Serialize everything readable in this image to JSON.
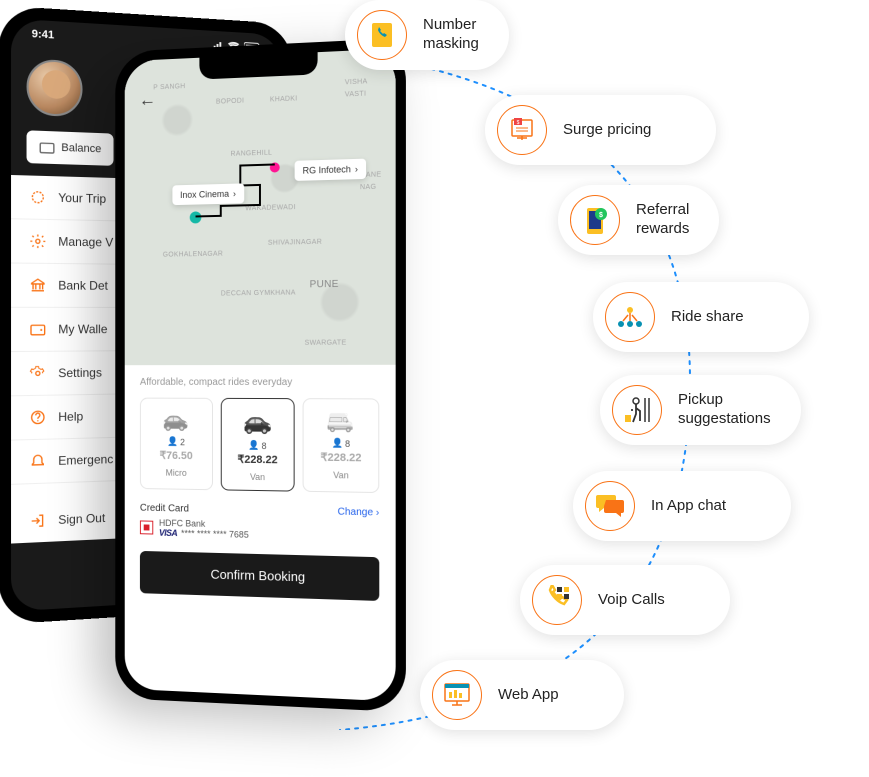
{
  "phone_back": {
    "status_time": "9:41",
    "balance_label": "Balance",
    "menu": [
      {
        "label": "Your Trip",
        "icon": "trips-icon"
      },
      {
        "label": "Manage V",
        "icon": "manage-icon"
      },
      {
        "label": "Bank Det",
        "icon": "bank-icon"
      },
      {
        "label": "My Walle",
        "icon": "wallet-icon"
      },
      {
        "label": "Settings",
        "icon": "settings-icon"
      },
      {
        "label": "Help",
        "icon": "help-icon"
      },
      {
        "label": "Emergenc",
        "icon": "emergency-icon"
      }
    ],
    "signout_label": "Sign Out"
  },
  "phone_front": {
    "map": {
      "labels": [
        "P SANGH",
        "BOPODI",
        "KHADKI",
        "VISHA",
        "VASTI",
        "RANGEHILL",
        "GANE",
        "NAG",
        "WAKADEWADI",
        "GOKHALENAGAR",
        "SHIVAJINAGAR",
        "DECCAN GYMKHANA",
        "Pune",
        "SWARGATE"
      ],
      "pin_start": "Inox Cinema",
      "pin_end": "RG Infotech"
    },
    "booking": {
      "tagline": "Affordable, compact rides everyday",
      "vehicles": [
        {
          "name": "Micro",
          "passengers": "2",
          "price": "₹76.50"
        },
        {
          "name": "Van",
          "passengers": "8",
          "price": "₹228.22"
        },
        {
          "name": "Van",
          "passengers": "8",
          "price": "₹228.22"
        }
      ],
      "card_title": "Credit Card",
      "change_label": "Change",
      "bank_name": "HDFC Bank",
      "card_mask": "**** **** **** 7685",
      "visa": "VISA",
      "confirm_label": "Confirm Booking"
    }
  },
  "features": [
    {
      "label": "Number\nmasking",
      "icon": "phone-book"
    },
    {
      "label": "Surge pricing",
      "icon": "surge"
    },
    {
      "label": "Referral\nrewards",
      "icon": "referral"
    },
    {
      "label": "Ride share",
      "icon": "ride-share"
    },
    {
      "label": "Pickup\nsuggestations",
      "icon": "pickup"
    },
    {
      "label": "In App chat",
      "icon": "chat"
    },
    {
      "label": "Voip Calls",
      "icon": "voip"
    },
    {
      "label": "Web App",
      "icon": "web-app"
    }
  ]
}
